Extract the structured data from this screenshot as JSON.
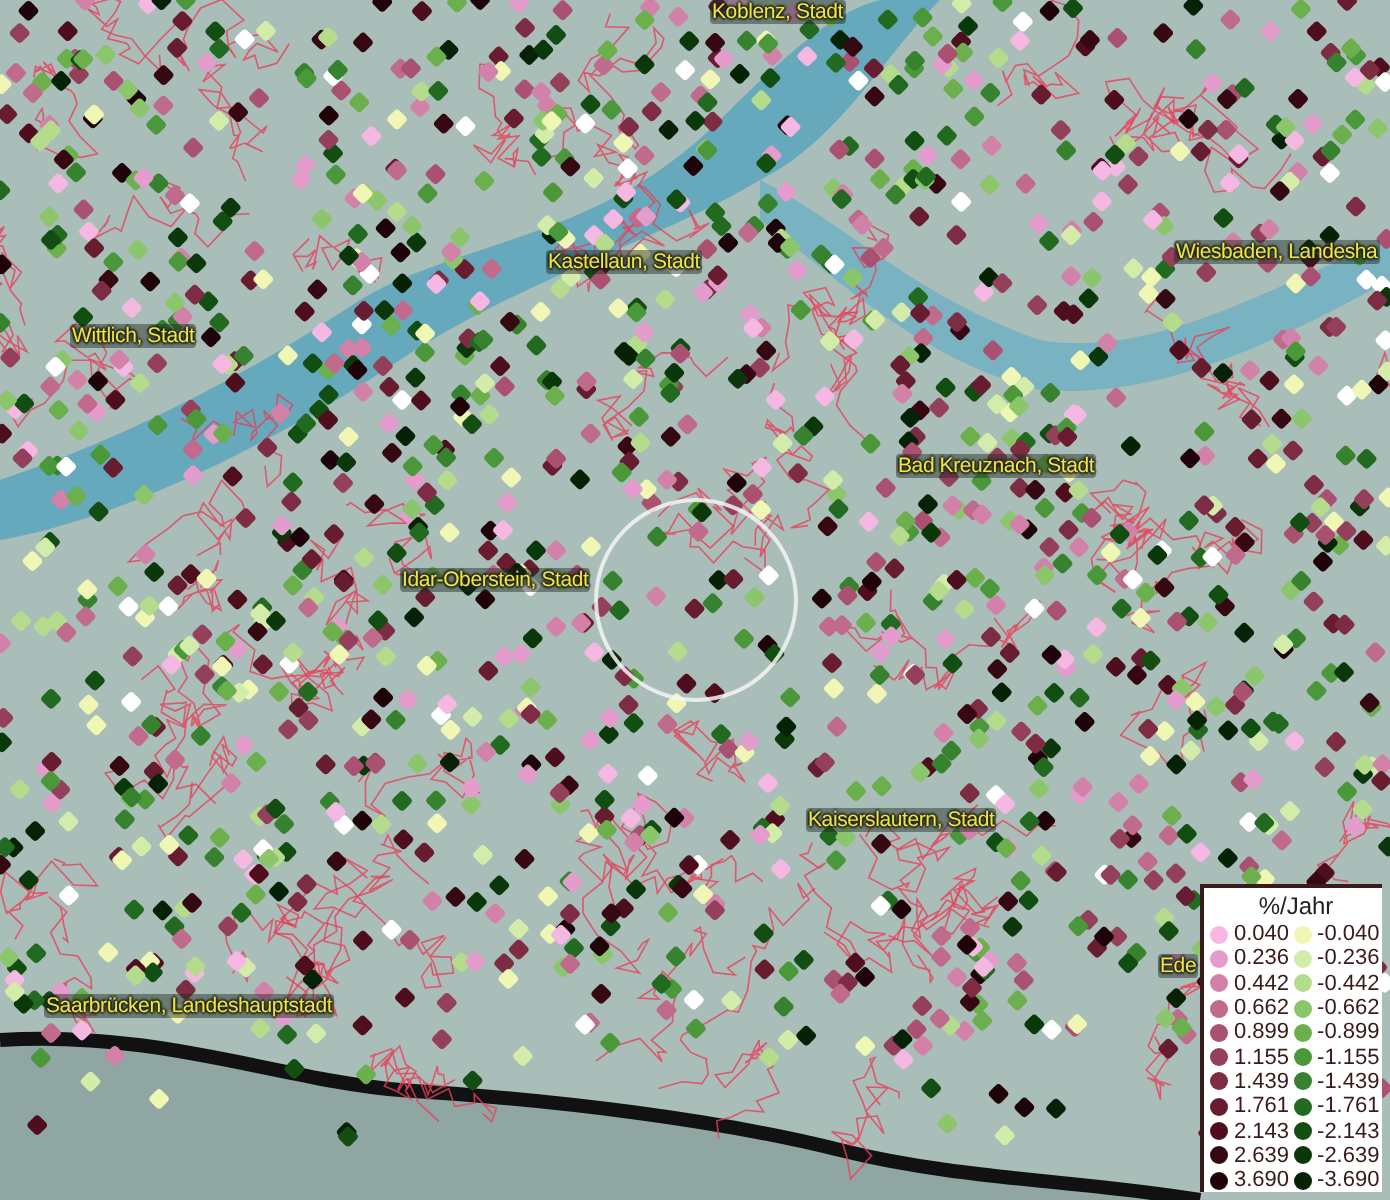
{
  "map": {
    "places": [
      {
        "name": "Koblenz, Stadt"
      },
      {
        "name": "Kastellaun, Stadt"
      },
      {
        "name": "Wiesbaden, Landesha"
      },
      {
        "name": "Wittlich, Stadt"
      },
      {
        "name": "Bad Kreuznach, Stadt"
      },
      {
        "name": "Idar-Oberstein, Stadt"
      },
      {
        "name": "Kaiserslautern, Stadt"
      },
      {
        "name": "Ede"
      },
      {
        "name": "Saarbrücken, Landeshauptstadt"
      }
    ]
  },
  "legend": {
    "title": "%/Jahr",
    "columns": [
      {
        "items": [
          {
            "label": "0.040",
            "color": "#f4b8e2"
          },
          {
            "label": "0.236",
            "color": "#e49ccc"
          },
          {
            "label": "0.442",
            "color": "#d282a8"
          },
          {
            "label": "0.662",
            "color": "#c06a8c"
          },
          {
            "label": "0.899",
            "color": "#aa5070"
          },
          {
            "label": "1.155",
            "color": "#94405a"
          },
          {
            "label": "1.439",
            "color": "#7e2c44"
          },
          {
            "label": "1.761",
            "color": "#681c30"
          },
          {
            "label": "2.143",
            "color": "#4e0e1e"
          },
          {
            "label": "2.639",
            "color": "#360812"
          },
          {
            "label": "3.690",
            "color": "#1e0408"
          }
        ]
      },
      {
        "items": [
          {
            "label": "-0.040",
            "color": "#f0f6b4"
          },
          {
            "label": "-0.236",
            "color": "#d4ecaa"
          },
          {
            "label": "-0.442",
            "color": "#b4dc8c"
          },
          {
            "label": "-0.662",
            "color": "#8cc66c"
          },
          {
            "label": "-0.899",
            "color": "#6cb04e"
          },
          {
            "label": "-1.155",
            "color": "#4a983a"
          },
          {
            "label": "-1.439",
            "color": "#36822e"
          },
          {
            "label": "-1.761",
            "color": "#226a20"
          },
          {
            "label": "-2.143",
            "color": "#124e12"
          },
          {
            "label": "-2.639",
            "color": "#0a380a"
          },
          {
            "label": "-3.690",
            "color": "#062206"
          }
        ]
      }
    ]
  }
}
